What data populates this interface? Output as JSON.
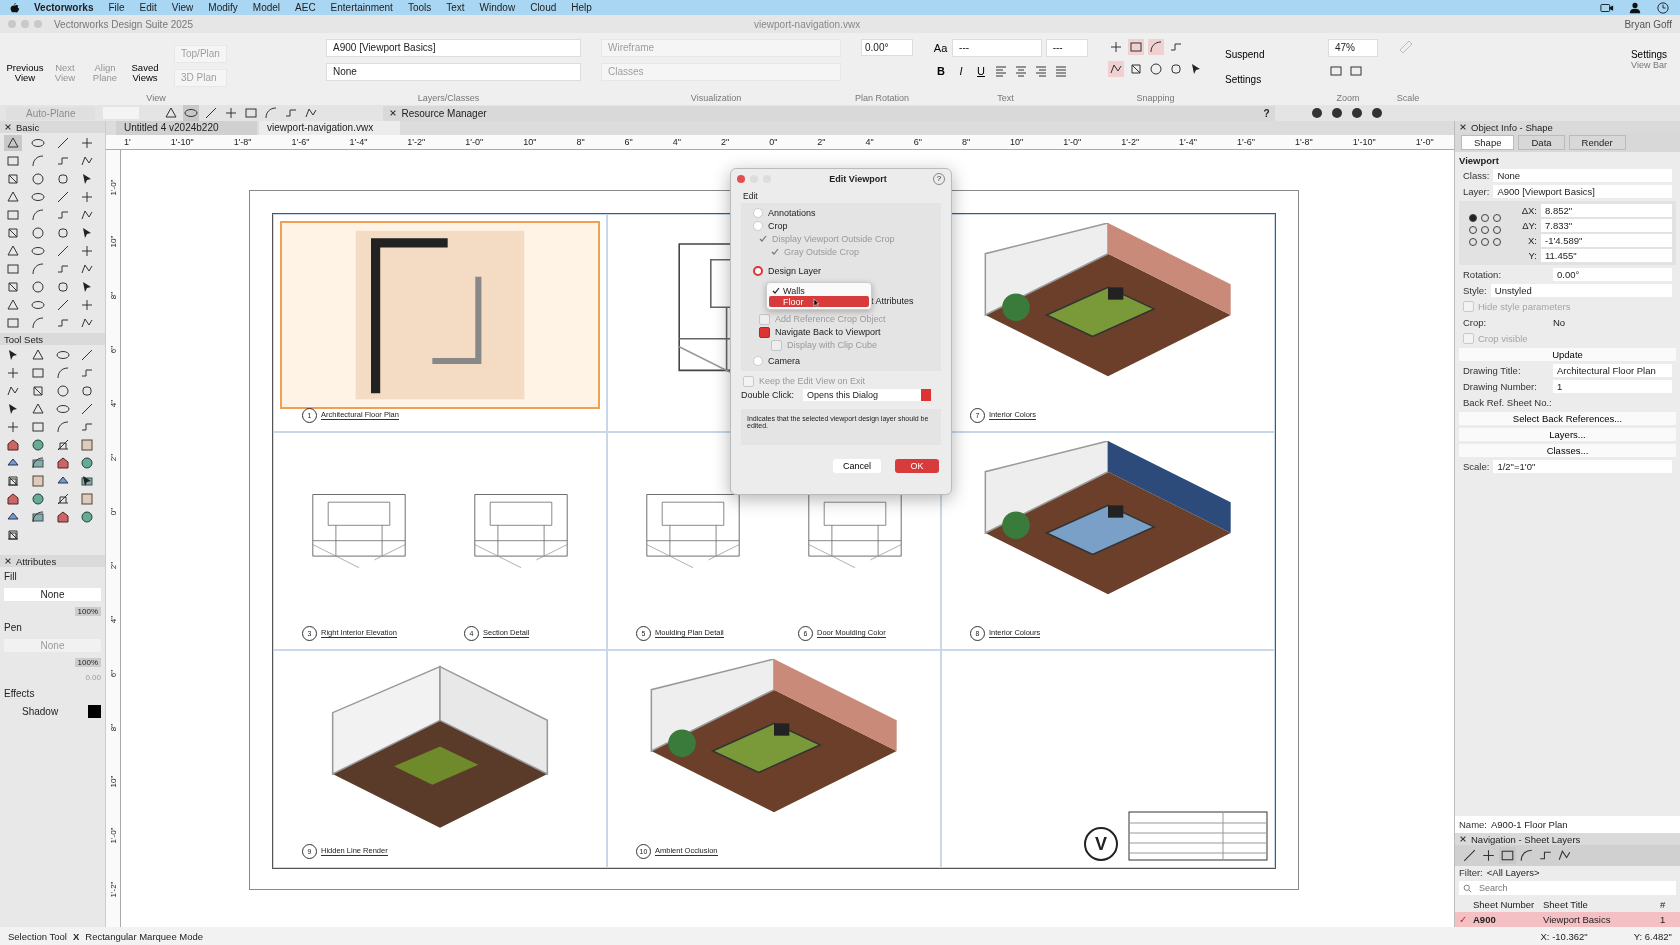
{
  "menu_bar": {
    "items": [
      "Vectorworks",
      "File",
      "Edit",
      "View",
      "Modify",
      "Model",
      "AEC",
      "Entertainment",
      "Tools",
      "Text",
      "Window",
      "Cloud",
      "Help"
    ]
  },
  "window": {
    "title": "Vectorworks Design Suite 2025",
    "document": "viewport-navigation.vwx",
    "user": "Bryan Goff"
  },
  "toolbar": {
    "view": {
      "label": "View",
      "buttons": [
        {
          "label": "Previous View",
          "disabled": false
        },
        {
          "label": "Next View",
          "disabled": true
        },
        {
          "label": "Align Plane",
          "disabled": true
        },
        {
          "label": "Saved Views",
          "disabled": false
        }
      ],
      "plane": "Top/Plan",
      "projection": "3D Plan"
    },
    "layers": {
      "label": "Layers/Classes",
      "layer": "A900 [Viewport Basics]",
      "class": "None"
    },
    "visualization": {
      "label": "Visualization",
      "render_mode": "Wireframe",
      "lighting": "Classes"
    },
    "plan_rotation": {
      "label": "Plan Rotation",
      "value": "0.00°"
    },
    "text": {
      "label": "Text",
      "font_button": "Aa",
      "font": "---",
      "size": "---",
      "styles": [
        "B",
        "I",
        "U"
      ]
    },
    "snapping": {
      "label": "Snapping"
    },
    "actions": [
      {
        "label": "Suspend"
      },
      {
        "label": "Settings"
      }
    ],
    "zoom": {
      "label": "Zoom",
      "value": "47%"
    },
    "scale": {
      "label": "Scale"
    },
    "view_bar": {
      "label": "View Bar",
      "button": "Settings"
    }
  },
  "mode_bar": {
    "auto_plane": "Auto-Plane",
    "resource_manager": "Resource Manager",
    "help": "?"
  },
  "tabs": [
    {
      "label": "Untitled 4 v2024b220",
      "selected": false
    },
    {
      "label": "viewport-navigation.vwx",
      "selected": true
    }
  ],
  "palettes": {
    "basic": "Basic",
    "tool_sets": "Tool Sets",
    "attributes": {
      "title": "Attributes",
      "fill_label": "Fill",
      "fill": "None",
      "fill_opacity": "100%",
      "pen_label": "Pen",
      "pen": "None",
      "pen_opacity": "100%",
      "thickness": "0.00",
      "effects": "Effects",
      "shadow": "Shadow"
    }
  },
  "rulers": {
    "top": [
      "1'",
      "1'-10\"",
      "1'-8\"",
      "1'-6\"",
      "1'-4\"",
      "1'-2\"",
      "1'-0\"",
      "10\"",
      "8\"",
      "6\"",
      "4\"",
      "2\"",
      "0\"",
      "2\"",
      "4\"",
      "6\"",
      "8\"",
      "10\"",
      "1'-0\"",
      "1'-2\"",
      "1'-4\"",
      "1'-6\"",
      "1'-8\"",
      "1'-10\"",
      "1'-0\""
    ],
    "left": [
      "1'-0\"",
      "10\"",
      "8\"",
      "6\"",
      "4\"",
      "2\"",
      "0\"",
      "2\"",
      "4\"",
      "6\"",
      "8\"",
      "10\"",
      "1'-0\"",
      "1'-2\""
    ]
  },
  "sheet": {
    "cells": [
      {
        "views": [
          {
            "number": "1",
            "title": "Architectural Floor Plan",
            "selected": true
          }
        ]
      },
      {
        "views": [
          {
            "selected": false
          }
        ]
      },
      {
        "views": [
          {
            "number": "7",
            "title": "Interior Colors",
            "selected": false
          }
        ]
      },
      {
        "views": [
          {
            "number": "3",
            "title": "Right Interior Elevation",
            "selected": false
          },
          {
            "number": "4",
            "title": "Section Detail",
            "selected": false
          }
        ]
      },
      {
        "views": [
          {
            "number": "5",
            "title": "Moulding Plan Detail",
            "selected": false
          },
          {
            "number": "6",
            "title": "Door Moulding Color",
            "selected": false
          }
        ]
      },
      {
        "views": [
          {
            "number": "8",
            "title": "Interior Colours",
            "selected": false
          }
        ]
      },
      {
        "views": [
          {
            "number": "9",
            "title": "Hidden Line Render",
            "selected": false
          }
        ]
      },
      {
        "views": [
          {
            "number": "10",
            "title": "Ambient Occlusion",
            "selected": false
          }
        ]
      }
    ],
    "title_block": {
      "logo": "V"
    }
  },
  "dialog": {
    "title": "Edit Viewport",
    "help": "?",
    "group": "Edit",
    "options": [
      {
        "label": "Annotations",
        "selected": false
      },
      {
        "label": "Crop",
        "selected": false
      }
    ],
    "crop_options": [
      {
        "label": "Display Viewport Outside Crop",
        "checked": true
      },
      {
        "label": "Gray Outside Crop",
        "checked": true
      }
    ],
    "design_layer": {
      "label": "Design Layer",
      "selected": true
    },
    "layer_menu": [
      {
        "label": "Walls",
        "checked": true,
        "selected": false
      },
      {
        "label": "Floor",
        "checked": false,
        "selected": true
      }
    ],
    "covered_text": "t Attributes",
    "layer_options": [
      {
        "label": "Add Reference Crop Object",
        "checked": false,
        "disabled": true
      },
      {
        "label": "Navigate Back to Viewport",
        "checked": true,
        "disabled": false
      },
      {
        "label": "Display with Clip Cube",
        "checked": false,
        "disabled": true
      }
    ],
    "camera": {
      "label": "Camera",
      "selected": false
    },
    "keep": {
      "label": "Keep the Edit View on Exit",
      "checked": false
    },
    "double_click_label": "Double Click:",
    "double_click": "Opens this Dialog",
    "description": "Indicates that the selected viewport design layer should be edited.",
    "buttons": [
      {
        "label": "Cancel",
        "kind": "secondary"
      },
      {
        "label": "OK",
        "kind": "primary"
      }
    ]
  },
  "object_info": {
    "title": "Object Info - Shape",
    "tabs": [
      {
        "label": "Shape",
        "selected": true
      },
      {
        "label": "Data",
        "selected": false
      },
      {
        "label": "Render",
        "selected": false
      }
    ],
    "object": "Viewport",
    "rows": [
      {
        "kind": "select",
        "label": "Class:",
        "value": "None"
      },
      {
        "kind": "select",
        "label": "Layer:",
        "value": "A900 [Viewport Basics]"
      },
      {
        "kind": "position",
        "anchors": [
          {
            "selected": true
          },
          {
            "selected": false
          },
          {
            "selected": false
          },
          {
            "selected": false
          },
          {
            "selected": false
          },
          {
            "selected": false
          },
          {
            "selected": false
          },
          {
            "selected": false
          },
          {
            "selected": false
          }
        ],
        "fields": [
          {
            "label": "ΔX:",
            "value": "8.852\""
          },
          {
            "label": "ΔY:",
            "value": "7.833\""
          },
          {
            "label": "X:",
            "value": "-1'4.589\""
          },
          {
            "label": "Y:",
            "value": "11.455\""
          }
        ]
      },
      {
        "kind": "field",
        "label": "Rotation:",
        "value": "0.00°"
      },
      {
        "kind": "select",
        "label": "Style:",
        "value": "Unstyled"
      },
      {
        "kind": "checkbox",
        "label": "Hide style parameters",
        "checked": false,
        "disabled": true
      },
      {
        "kind": "text",
        "label": "Crop:",
        "value": "No"
      },
      {
        "kind": "checkbox",
        "label": "Crop visible",
        "checked": false,
        "disabled": true
      },
      {
        "kind": "button",
        "label": "Update"
      },
      {
        "kind": "field",
        "label": "Drawing Title:",
        "value": "Architectural Floor Plan"
      },
      {
        "kind": "field",
        "label": "Drawing Number:",
        "value": "1"
      },
      {
        "kind": "label",
        "label": "Back Ref. Sheet No.:"
      },
      {
        "kind": "button",
        "label": "Select Back References..."
      },
      {
        "kind": "button",
        "label": "Layers..."
      },
      {
        "kind": "button",
        "label": "Classes..."
      },
      {
        "kind": "select",
        "label": "Scale:",
        "value": "1/2\"=1'0\""
      }
    ],
    "name_label": "Name:",
    "name": "A900-1 Floor Plan"
  },
  "navigation": {
    "title": "Navigation - Sheet Layers",
    "filter_label": "Filter:",
    "filter": "<All Layers>",
    "search": {
      "placeholder": "Search"
    },
    "columns": [
      "Sheet Number",
      "Sheet Title",
      "#"
    ],
    "rows": [
      {
        "check": "✓",
        "number": "A900",
        "title": "Viewport Basics",
        "count": "1",
        "selected": true
      }
    ]
  },
  "status_bar": {
    "tool": "Selection Tool",
    "separator": "X",
    "mode": "Rectangular Marquee Mode",
    "x": "X: -10.362\"",
    "y": "Y: 6.482\""
  }
}
